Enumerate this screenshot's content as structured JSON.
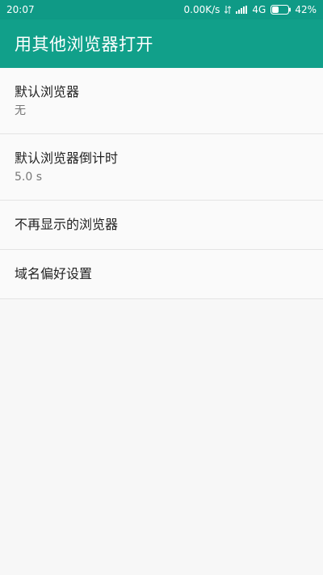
{
  "status_bar": {
    "time": "20:07",
    "net_speed": "0.00K/s",
    "network_type": "4G",
    "battery_percent": "42%",
    "battery_level": 0.42
  },
  "app_bar": {
    "title": "用其他浏览器打开"
  },
  "settings": {
    "items": [
      {
        "title": "默认浏览器",
        "summary": "无"
      },
      {
        "title": "默认浏览器倒计时",
        "summary": "5.0 s"
      },
      {
        "title": "不再显示的浏览器"
      },
      {
        "title": "域名偏好设置"
      }
    ]
  },
  "colors": {
    "status_bar": "#0f9a86",
    "app_bar": "#11a08a",
    "background": "#f7f7f7"
  }
}
